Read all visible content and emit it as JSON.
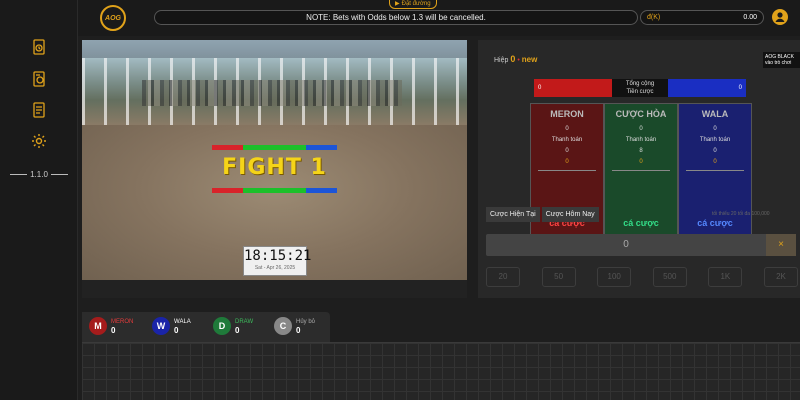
{
  "topbar": {
    "logo_text": "AOG",
    "guide_label": "Đặt đường",
    "notice": "NOTE: Bets with Odds below 1.3 will be cancelled.",
    "balance_unit": "đ(K)",
    "balance_value": "0.00"
  },
  "sidebar": {
    "items": [
      {
        "icon": "history-icon"
      },
      {
        "icon": "coin-bet-icon"
      },
      {
        "icon": "document-icon"
      },
      {
        "icon": "gear-icon"
      }
    ],
    "version": "1.1.0"
  },
  "video": {
    "fight_title": "FIGHT 1",
    "clock_time": "18:15:21",
    "clock_date": "Sat - Apr 26, 2025"
  },
  "round": {
    "label": "Hiệp",
    "number": "0",
    "dot": "•",
    "status": "new"
  },
  "promo_text": "AOG BLACK vào trò chơi",
  "totals": {
    "meron": "0",
    "label_line1": "Tổng cộng",
    "label_line2": "Tiền cược",
    "wala": "0"
  },
  "bets": [
    {
      "name": "MERON",
      "v1": "0",
      "paid_label": "Thanh toán",
      "v2": "0",
      "odds": "0",
      "cta": "cá cược"
    },
    {
      "name": "CƯỢC HÒA",
      "v1": "0",
      "paid_label": "Thanh toán",
      "v2": "8",
      "odds": "0",
      "cta": "cá cược"
    },
    {
      "name": "WALA",
      "v1": "0",
      "paid_label": "Thanh toán",
      "v2": "0",
      "odds": "0",
      "cta": "cá cược"
    }
  ],
  "tabs": [
    "Cược Hiện Tại",
    "Cược Hôm Nay"
  ],
  "limits": "tối thiểu 20  tối đa 100,000",
  "amount": {
    "value": "0",
    "clear": "×"
  },
  "chips": [
    "20",
    "50",
    "100",
    "500",
    "1K",
    "2K"
  ],
  "legend": [
    {
      "letter": "M",
      "label": "MERON",
      "count": "0",
      "color": "#a51c1c",
      "text_color": "#e63b3b"
    },
    {
      "letter": "W",
      "label": "WALA",
      "count": "0",
      "color": "#1a24a8",
      "text_color": "#ffffff"
    },
    {
      "letter": "D",
      "label": "DRAW",
      "count": "0",
      "color": "#1f7a3a",
      "text_color": "#3dbb5c"
    },
    {
      "letter": "C",
      "label": "Hủy bỏ",
      "count": "0",
      "color": "#888888",
      "text_color": "#aaaaaa"
    }
  ]
}
